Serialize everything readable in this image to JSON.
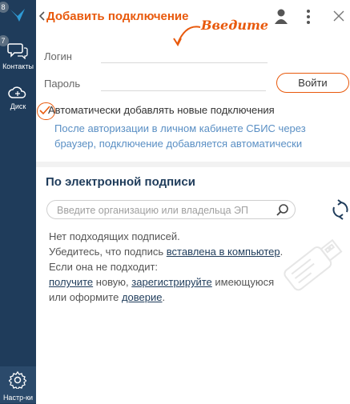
{
  "sidebar": {
    "logo_badge": "8",
    "contacts": {
      "badge": "7",
      "label": "Контакты"
    },
    "disk": {
      "label": "Диск"
    },
    "settings": {
      "label": "Настр-ки"
    }
  },
  "header": {
    "title": "Добавить подключение",
    "annotation": "Введите"
  },
  "form": {
    "login_label": "Логин",
    "login_value": "",
    "password_label": "Пароль",
    "password_value": "",
    "login_button": "Войти",
    "auto_add_label": "Автоматически добавлять новые подключения",
    "auto_add_checked": true,
    "auto_add_hint": "После авторизации в личном кабинете СБИС через браузер, подключение добавляется автоматически"
  },
  "signature": {
    "title": "По электронной подписи",
    "search_placeholder": "Введите организацию или владельца ЭП",
    "empty_line1": "Нет подходящих подписей.",
    "empty_line2_prefix": "Убедитесь, что подпись ",
    "empty_line2_link": "вставлена в компьютер",
    "empty_line2_suffix": ".",
    "empty_line3": "Если она не подходит:",
    "link_get": "получите",
    "text_new": " новую, ",
    "link_register": "зарегистрируйте",
    "text_existing": " имеющуюся",
    "text_or": "или оформите ",
    "link_trust": "доверие",
    "text_end": "."
  },
  "colors": {
    "accent": "#e8590c",
    "sidebar": "#1f3c5b",
    "hint": "#5a8fc4"
  }
}
